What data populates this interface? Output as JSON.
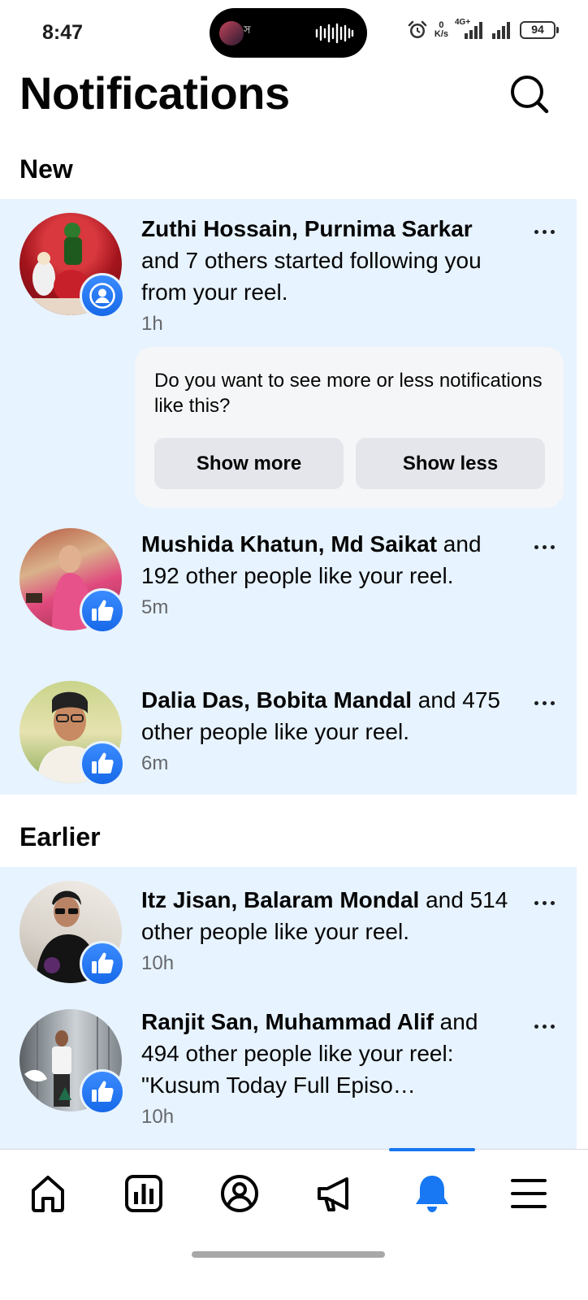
{
  "status_bar": {
    "time": "8:47",
    "island_text": "স",
    "net_speed_value": "0",
    "net_speed_unit": "K/s",
    "network_label": "4G+",
    "battery": "94"
  },
  "header": {
    "title": "Notifications"
  },
  "sections": {
    "new_title": "New",
    "earlier_title": "Earlier"
  },
  "notifications": [
    {
      "name1": "Zuthi Hossain",
      "sep": ", ",
      "name2": "Purnima Sarkar",
      "rest": " and 7 others started following you from your reel.",
      "time": "1h",
      "badge_icon": "person-icon"
    },
    {
      "name1": "Mushida Khatun",
      "sep": ", ",
      "name2": "Md Saikat",
      "rest": " and 192 other people like your reel.",
      "time": "5m",
      "badge_icon": "like-icon"
    },
    {
      "name1": "Dalia Das",
      "sep": ", ",
      "name2": "Bobita Mandal",
      "rest": " and 475 other people like your reel.",
      "time": "6m",
      "badge_icon": "like-icon"
    },
    {
      "name1": "Itz Jisan",
      "sep": ", ",
      "name2": "Balaram Mondal",
      "rest": " and 514 other people like your reel.",
      "time": "10h",
      "badge_icon": "like-icon"
    },
    {
      "name1": "Ranjit San",
      "sep": ", ",
      "name2": "Muhammad Alif",
      "rest": " and 494 other people like your reel: \"Kusum Today Full Episo…",
      "time": "10h",
      "badge_icon": "like-icon"
    }
  ],
  "feedback": {
    "question": "Do you want to see more or less notifications like this?",
    "show_more": "Show more",
    "show_less": "Show less"
  },
  "bottom_nav": {
    "items": [
      "home-icon",
      "dashboard-icon",
      "profile-icon",
      "megaphone-icon",
      "bell-icon",
      "menu-icon"
    ],
    "active": "bell-icon",
    "active_color": "#1877f2"
  },
  "colors": {
    "unread_bg": "#e7f3ff",
    "badge_blue": "#1877f2",
    "secondary_text": "#65676b"
  }
}
